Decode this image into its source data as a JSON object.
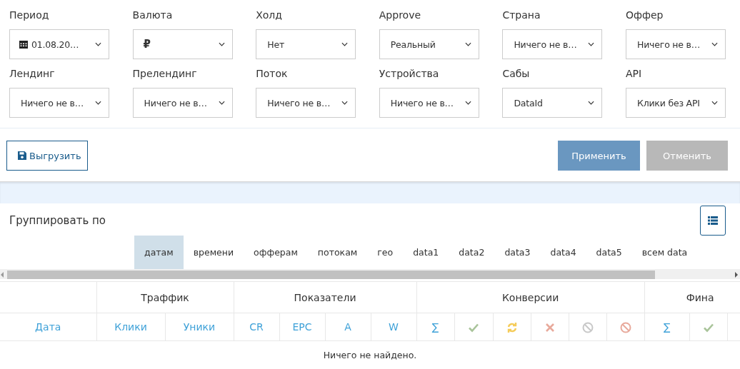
{
  "filters": [
    {
      "label": "Период",
      "value": "01.08.20…",
      "kind": "date"
    },
    {
      "label": "Валюта",
      "value": "₽",
      "kind": "currency"
    },
    {
      "label": "Холд",
      "value": "Нет",
      "kind": "select"
    },
    {
      "label": "Approve",
      "value": "Реальный",
      "kind": "select"
    },
    {
      "label": "Страна",
      "value": "Ничего не в…",
      "kind": "select"
    },
    {
      "label": "Оффер",
      "value": "Ничего не в…",
      "kind": "select"
    },
    {
      "label": "Лендинг",
      "value": "Ничего не в…",
      "kind": "select"
    },
    {
      "label": "Прелендинг",
      "value": "Ничего не в…",
      "kind": "select"
    },
    {
      "label": "Поток",
      "value": "Ничего не в…",
      "kind": "select"
    },
    {
      "label": "Устройства",
      "value": "Ничего не в…",
      "kind": "select"
    },
    {
      "label": "Сабы",
      "value": "DataId",
      "kind": "select"
    },
    {
      "label": "API",
      "value": "Клики без API",
      "kind": "select"
    }
  ],
  "export_button": "Выгрузить",
  "apply_button": "Применить",
  "cancel_button": {
    "label": "Отменить",
    "disabled": true
  },
  "group_by": {
    "title": "Группировать по",
    "tabs": [
      {
        "label": "датам",
        "selected": true
      },
      {
        "label": "времени",
        "selected": false
      },
      {
        "label": "офферам",
        "selected": false
      },
      {
        "label": "потокам",
        "selected": false
      },
      {
        "label": "гео",
        "selected": false
      },
      {
        "label": "data1",
        "selected": false
      },
      {
        "label": "data2",
        "selected": false
      },
      {
        "label": "data3",
        "selected": false
      },
      {
        "label": "data4",
        "selected": false
      },
      {
        "label": "data5",
        "selected": false
      },
      {
        "label": "всем data",
        "selected": false
      }
    ]
  },
  "table": {
    "groups": [
      {
        "columns": [
          {
            "kind": "text",
            "label": "Дата"
          }
        ]
      },
      {
        "label": "Траффик",
        "columns": [
          {
            "kind": "text",
            "label": "Клики"
          },
          {
            "kind": "text",
            "label": "Уники"
          }
        ]
      },
      {
        "label": "Показатели",
        "columns": [
          {
            "kind": "text",
            "label": "CR"
          },
          {
            "kind": "text",
            "label": "EPC"
          },
          {
            "kind": "text",
            "label": "A"
          },
          {
            "kind": "text",
            "label": "W"
          }
        ]
      },
      {
        "label": "Конверсии",
        "columns": [
          {
            "kind": "text",
            "label": "∑"
          },
          {
            "kind": "check"
          },
          {
            "kind": "refresh"
          },
          {
            "kind": "cross"
          },
          {
            "kind": "ban"
          },
          {
            "kind": "ban-red"
          }
        ]
      },
      {
        "label": "Фина",
        "columns": [
          {
            "kind": "text",
            "label": "∑"
          },
          {
            "kind": "check"
          },
          {
            "kind": "blank"
          }
        ]
      }
    ],
    "empty_message": "Ничего не найдено."
  }
}
